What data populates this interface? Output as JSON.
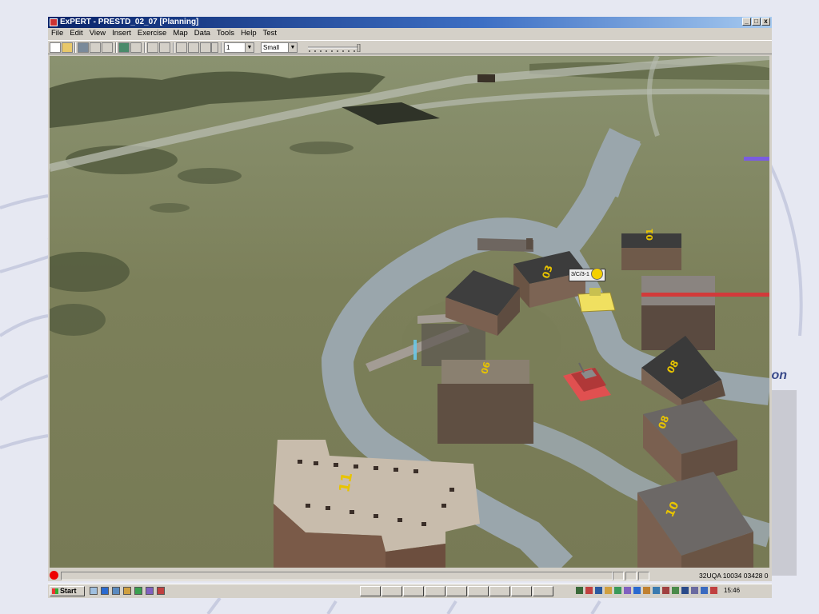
{
  "slide": {
    "partial_text": "ion"
  },
  "window": {
    "title": "ExPERT - PRESTD_02_07 [Planning]",
    "buttons": [
      "_",
      "□",
      "x"
    ]
  },
  "menu": [
    "File",
    "Edit",
    "View",
    "Insert",
    "Exercise",
    "Map",
    "Data",
    "Tools",
    "Help",
    "Test"
  ],
  "toolbar": {
    "number_combo": "1",
    "size_combo": "Small"
  },
  "map": {
    "unit_label": "3/C/3-1",
    "building_numbers": [
      "01",
      "03",
      "06",
      "06",
      "08",
      "08",
      "10",
      "11"
    ]
  },
  "status": {
    "coordinates": "32UQA 10034 03428 0"
  },
  "taskbar": {
    "start_label": "Start",
    "clock": "15:46"
  },
  "colors": {
    "titlebar": "#0a246a",
    "unit_yellow": "#f0e060",
    "unit_red": "#e05050",
    "road": "#9aa6ac",
    "terrain": "#7a7e5a"
  }
}
